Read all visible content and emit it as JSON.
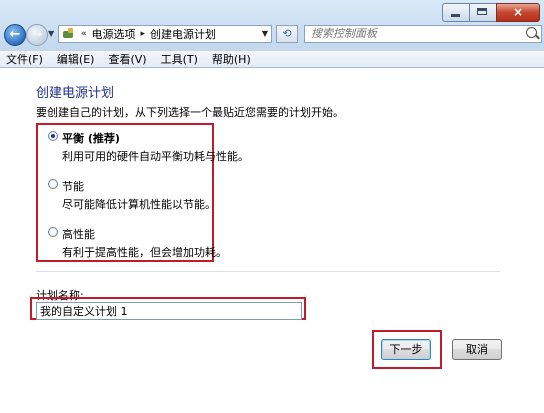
{
  "address": {
    "breadcrumb": [
      "电源选项",
      "创建电源计划"
    ],
    "overflow_glyph": "«",
    "separator_glyph": "▸"
  },
  "search": {
    "placeholder": "搜索控制面板"
  },
  "menu": [
    "文件(F)",
    "编辑(E)",
    "查看(V)",
    "工具(T)",
    "帮助(H)"
  ],
  "page": {
    "title": "创建电源计划",
    "subtitle": "要创建自己的计划，从下列选择一个最贴近您需要的计划开始。"
  },
  "plans": [
    {
      "label": "平衡 (推荐)",
      "description": "利用可用的硬件自动平衡功耗与性能。",
      "selected": true
    },
    {
      "label": "节能",
      "description": "尽可能降低计算机性能以节能。",
      "selected": false
    },
    {
      "label": "高性能",
      "description": "有利于提高性能，但会增加功耗。",
      "selected": false
    }
  ],
  "plan_name": {
    "label": "计划名称:",
    "value": "我的自定义计划 1"
  },
  "buttons": {
    "next": "下一步",
    "cancel": "取消"
  },
  "window": {
    "close_glyph": "×"
  },
  "colors": {
    "highlight": "#c41b2a",
    "title": "#1e3287",
    "window_frame": "#cfe0f1"
  }
}
